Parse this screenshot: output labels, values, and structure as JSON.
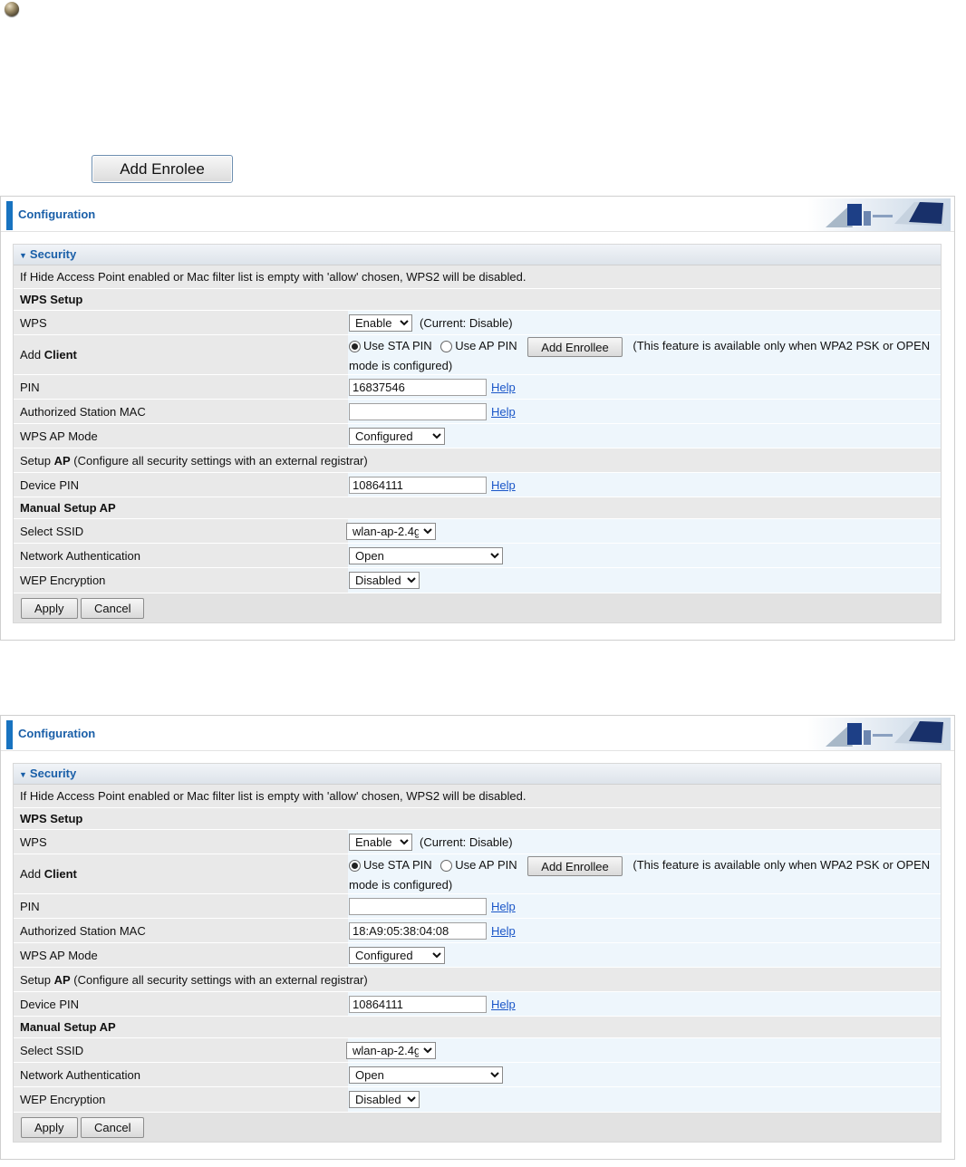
{
  "top_button_label": "Add Enrolee",
  "panels": [
    {
      "header_title": "Configuration",
      "section_title": "Security",
      "notice": "If Hide Access Point enabled or Mac filter list is empty with 'allow' chosen, WPS2 will be disabled.",
      "wps_setup_title": "WPS Setup",
      "wps_label": "WPS",
      "wps_value": "Enable",
      "wps_current": "(Current: Disable)",
      "add_client_prefix": "Add ",
      "add_client_bold": "Client",
      "use_sta_pin": "Use STA PIN",
      "use_ap_pin": "Use AP PIN",
      "add_enrollee_button": "Add Enrollee",
      "client_note_1": "(This feature is available only when WPA2 PSK or OPEN",
      "client_note_2": "mode is configured)",
      "pin_label": "PIN",
      "pin_value": "16837546",
      "help": "Help",
      "auth_mac_label": "Authorized Station MAC",
      "auth_mac_value": "",
      "wps_ap_mode_label": "WPS AP Mode",
      "wps_ap_mode_value": "Configured",
      "setup_ap_prefix": "Setup ",
      "setup_ap_bold": "AP",
      "setup_ap_suffix": " (Configure all security settings with an external registrar)",
      "device_pin_label": "Device PIN",
      "device_pin_value": "10864111",
      "manual_setup_title": "Manual Setup AP",
      "select_ssid_label": "Select SSID",
      "select_ssid_value": "wlan-ap-2.4g",
      "net_auth_label": "Network Authentication",
      "net_auth_value": "Open",
      "wep_label": "WEP Encryption",
      "wep_value": "Disabled",
      "apply": "Apply",
      "cancel": "Cancel"
    },
    {
      "header_title": "Configuration",
      "section_title": "Security",
      "notice": "If Hide Access Point enabled or Mac filter list is empty with 'allow' chosen, WPS2 will be disabled.",
      "wps_setup_title": "WPS Setup",
      "wps_label": "WPS",
      "wps_value": "Enable",
      "wps_current": "(Current: Disable)",
      "add_client_prefix": "Add ",
      "add_client_bold": "Client",
      "use_sta_pin": "Use STA PIN",
      "use_ap_pin": "Use AP PIN",
      "add_enrollee_button": "Add Enrollee",
      "client_note_1": "(This feature is available only when WPA2 PSK or OPEN",
      "client_note_2": "mode is configured)",
      "pin_label": "PIN",
      "pin_value": "",
      "help": "Help",
      "auth_mac_label": "Authorized Station MAC",
      "auth_mac_value": "18:A9:05:38:04:08",
      "wps_ap_mode_label": "WPS AP Mode",
      "wps_ap_mode_value": "Configured",
      "setup_ap_prefix": "Setup ",
      "setup_ap_bold": "AP",
      "setup_ap_suffix": " (Configure all security settings with an external registrar)",
      "device_pin_label": "Device PIN",
      "device_pin_value": "10864111",
      "manual_setup_title": "Manual Setup AP",
      "select_ssid_label": "Select SSID",
      "select_ssid_value": "wlan-ap-2.4g",
      "net_auth_label": "Network Authentication",
      "net_auth_value": "Open",
      "wep_label": "WEP Encryption",
      "wep_value": "Disabled",
      "apply": "Apply",
      "cancel": "Cancel"
    }
  ]
}
